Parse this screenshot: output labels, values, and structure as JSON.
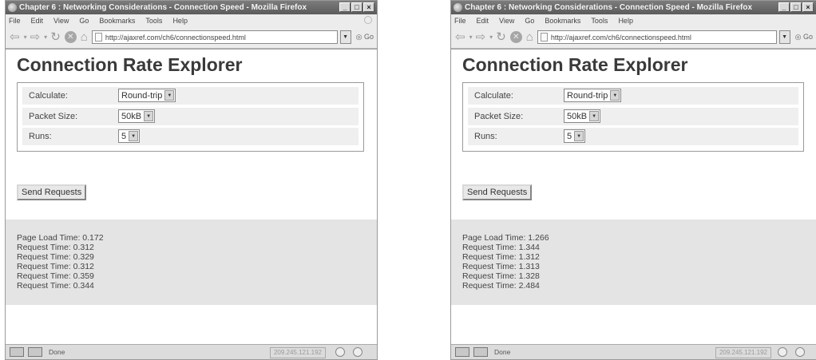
{
  "windows": [
    {
      "title": "Chapter 6 : Networking Considerations - Connection Speed - Mozilla Firefox",
      "menu": [
        "File",
        "Edit",
        "View",
        "Go",
        "Bookmarks",
        "Tools",
        "Help"
      ],
      "url": "http://ajaxref.com/ch6/connectionspeed.html",
      "go_label": "Go",
      "page_title": "Connection Rate Explorer",
      "fields": [
        {
          "label": "Calculate:",
          "value": "Round-trip"
        },
        {
          "label": "Packet Size:",
          "value": "50kB"
        },
        {
          "label": "Runs:",
          "value": "5"
        }
      ],
      "button_label": "Send Requests",
      "results": [
        "Page Load Time: 0.172",
        "Request Time: 0.312",
        "Request Time: 0.329",
        "Request Time: 0.312",
        "Request Time: 0.359",
        "Request Time: 0.344"
      ],
      "status": "Done",
      "ip": "209.245.121.192"
    },
    {
      "title": "Chapter 6 : Networking Considerations - Connection Speed - Mozilla Firefox",
      "menu": [
        "File",
        "Edit",
        "View",
        "Go",
        "Bookmarks",
        "Tools",
        "Help"
      ],
      "url": "http://ajaxref.com/ch6/connectionspeed.html",
      "go_label": "Go",
      "page_title": "Connection Rate Explorer",
      "fields": [
        {
          "label": "Calculate:",
          "value": "Round-trip"
        },
        {
          "label": "Packet Size:",
          "value": "50kB"
        },
        {
          "label": "Runs:",
          "value": "5"
        }
      ],
      "button_label": "Send Requests",
      "results": [
        "Page Load Time: 1.266",
        "Request Time: 1.344",
        "Request Time: 1.312",
        "Request Time: 1.313",
        "Request Time: 1.328",
        "Request Time: 2.484"
      ],
      "status": "Done",
      "ip": "209.245.121.192"
    }
  ]
}
